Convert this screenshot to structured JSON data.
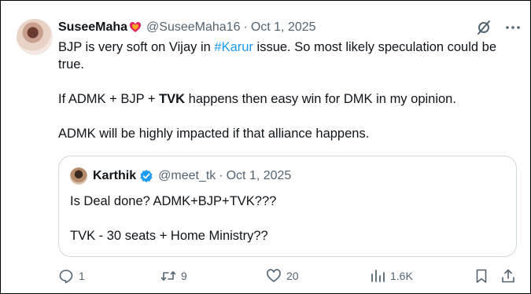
{
  "post": {
    "author_name": "SuseeMaha",
    "handle": "@SuseeMaha16",
    "separator": "·",
    "date": "Oct 1, 2025",
    "line1_before": "BJP is very soft on Vijay in ",
    "hashtag": "#Karur",
    "line1_after": " issue. So most likely speculation could be true.",
    "line2_before": "If ADMK + BJP + ",
    "line2_bold": "TVK",
    "line2_after": " happens then easy win for DMK in my opinion.",
    "line3": "ADMK will be highly impacted if that alliance happens."
  },
  "quote": {
    "author_name": "Karthik",
    "handle": "@meet_tk",
    "separator": "·",
    "date": "Oct 1, 2025",
    "line1": "Is Deal done? ADMK+BJP+TVK???",
    "line2": "TVK - 30 seats + Home Ministry??"
  },
  "actions": {
    "replies": "1",
    "reposts": "9",
    "likes": "20",
    "views": "1.6K"
  },
  "colors": {
    "link": "#1d9bf0",
    "muted": "#536471",
    "text": "#0f1419",
    "border": "#cfd9de"
  },
  "icons": [
    "heart-badge-icon",
    "grok-icon",
    "more-icon",
    "verified-icon",
    "reply-icon",
    "repost-icon",
    "like-icon",
    "views-icon",
    "bookmark-icon",
    "share-icon"
  ]
}
